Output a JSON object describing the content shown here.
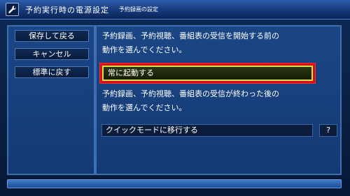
{
  "window": {
    "title": "予約実行時の電源設定",
    "subtitle": "予約録画の設定",
    "icon": "wrench-icon"
  },
  "sidebar": {
    "buttons": [
      {
        "label": "保存して戻る"
      },
      {
        "label": "キャンセル"
      },
      {
        "label": "標準に戻す"
      }
    ]
  },
  "main": {
    "before_desc_line1": "予約録画、予約視聴、番組表の受信を開始する前の",
    "before_desc_line2": "動作を選んでください。",
    "before_selected": "常に起動する",
    "after_desc_line1": "予約録画、予約視聴、番組表の受信が終わった後の",
    "after_desc_line2": "動作を選んでください。",
    "after_selected": "クイックモードに移行する",
    "help_label": "?"
  },
  "colors": {
    "background": "#0d2a55",
    "panel": "#1b4685",
    "focus_outline": "#d0121a",
    "selected_border": "#d8e04a"
  }
}
